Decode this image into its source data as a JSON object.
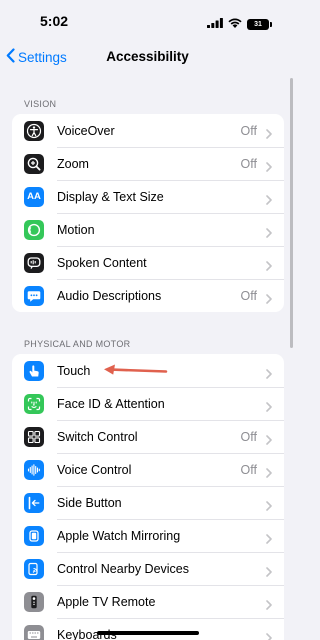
{
  "status_bar": {
    "time": "5:02",
    "battery_level": "31"
  },
  "nav": {
    "back_label": "Settings",
    "title": "Accessibility"
  },
  "sections": [
    {
      "header": "VISION",
      "rows": [
        {
          "label": "VoiceOver",
          "value": "Off",
          "icon": "voiceover-icon",
          "color": "#1c1c1e"
        },
        {
          "label": "Zoom",
          "value": "Off",
          "icon": "zoom-icon",
          "color": "#1c1c1e"
        },
        {
          "label": "Display & Text Size",
          "value": "",
          "icon": "text-size-icon",
          "color": "#0a84ff",
          "glyph": "AA"
        },
        {
          "label": "Motion",
          "value": "",
          "icon": "motion-icon",
          "color": "#34c759"
        },
        {
          "label": "Spoken Content",
          "value": "",
          "icon": "spoken-content-icon",
          "color": "#1c1c1e"
        },
        {
          "label": "Audio Descriptions",
          "value": "Off",
          "icon": "audio-descriptions-icon",
          "color": "#0a84ff"
        }
      ]
    },
    {
      "header": "PHYSICAL AND MOTOR",
      "rows": [
        {
          "label": "Touch",
          "value": "",
          "icon": "touch-icon",
          "color": "#0a84ff"
        },
        {
          "label": "Face ID & Attention",
          "value": "",
          "icon": "face-id-icon",
          "color": "#34c759"
        },
        {
          "label": "Switch Control",
          "value": "Off",
          "icon": "switch-control-icon",
          "color": "#1c1c1e"
        },
        {
          "label": "Voice Control",
          "value": "Off",
          "icon": "voice-control-icon",
          "color": "#0a84ff"
        },
        {
          "label": "Side Button",
          "value": "",
          "icon": "side-button-icon",
          "color": "#0a84ff"
        },
        {
          "label": "Apple Watch Mirroring",
          "value": "",
          "icon": "watch-mirroring-icon",
          "color": "#0a84ff"
        },
        {
          "label": "Control Nearby Devices",
          "value": "",
          "icon": "nearby-devices-icon",
          "color": "#0a84ff"
        },
        {
          "label": "Apple TV Remote",
          "value": "",
          "icon": "tv-remote-icon",
          "color": "#8e8e93"
        },
        {
          "label": "Keyboards",
          "value": "",
          "icon": "keyboard-icon",
          "color": "#8e8e93"
        }
      ]
    }
  ],
  "colors": {
    "accent": "#007aff",
    "annotation_arrow": "#e0614e"
  }
}
